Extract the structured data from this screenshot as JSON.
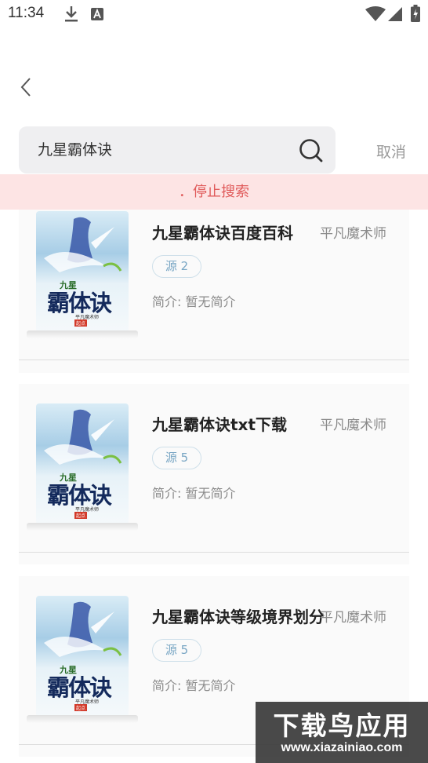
{
  "status_bar": {
    "time": "11:34",
    "icons": [
      "download-icon",
      "a-notification-icon",
      "wifi-icon",
      "signal-icon",
      "battery-icon"
    ]
  },
  "search": {
    "query": "九星霸体诀",
    "cancel_label": "取消"
  },
  "banner": {
    "stop_label": "．停止搜索"
  },
  "results": [
    {
      "title": "九星霸体诀百度百科",
      "author": "平凡魔术师",
      "source": "源 2",
      "intro": "简介: 暂无简介",
      "cover": {
        "big_text": "霸体诀",
        "small_text": "九星",
        "author_text": "平凡魔术师",
        "publisher": "起点"
      }
    },
    {
      "title": "九星霸体诀txt下载",
      "author": "平凡魔术师",
      "source": "源 5",
      "intro": "简介: 暂无简介",
      "cover": {
        "big_text": "霸体诀",
        "small_text": "九星",
        "author_text": "平凡魔术师",
        "publisher": "起点"
      }
    },
    {
      "title": "九星霸体诀等级境界划分",
      "author": "平凡魔术师",
      "source": "源 5",
      "intro": "简介: 暂无简介",
      "cover": {
        "big_text": "霸体诀",
        "small_text": "九星",
        "author_text": "平凡魔术师",
        "publisher": "起点"
      }
    }
  ],
  "watermark": {
    "title": "下载鸟应用",
    "url": "www.xiazainiao.com"
  },
  "colors": {
    "banner_bg": "#fde4e4",
    "banner_text": "#e05a5a",
    "badge_text": "#79a6c4",
    "search_bg": "#efeff1"
  }
}
